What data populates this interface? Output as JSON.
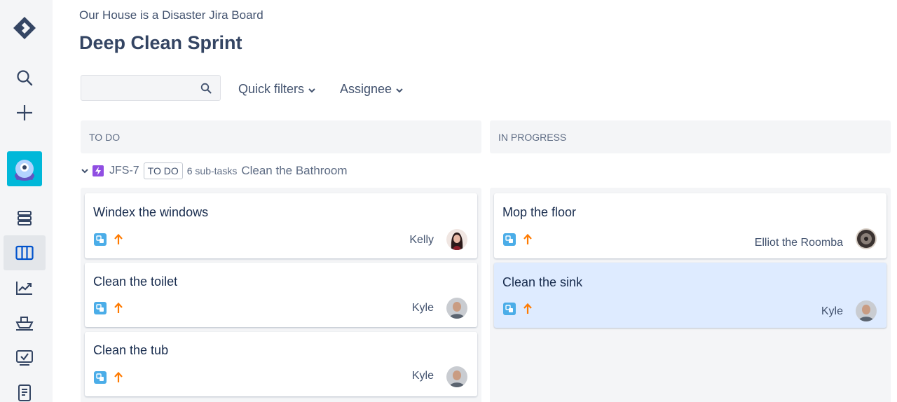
{
  "sidebar": {
    "items": [
      {
        "name": "jira-logo-icon"
      },
      {
        "name": "search-icon"
      },
      {
        "name": "create-icon"
      },
      {
        "name": "project-avatar"
      },
      {
        "name": "backlog-icon"
      },
      {
        "name": "board-icon"
      },
      {
        "name": "reports-icon"
      },
      {
        "name": "releases-icon"
      },
      {
        "name": "issues-icon"
      },
      {
        "name": "pages-icon"
      }
    ]
  },
  "header": {
    "breadcrumb": "Our House is a Disaster Jira Board",
    "title": "Deep Clean Sprint"
  },
  "filters": {
    "search_placeholder": "",
    "quick_filters": "Quick filters",
    "assignee": "Assignee"
  },
  "columns": [
    {
      "label": "TO DO"
    },
    {
      "label": "IN PROGRESS"
    }
  ],
  "swimlane": {
    "key": "JFS-7",
    "status": "TO DO",
    "subtasks": "6 sub-tasks",
    "title": "Clean the Bathroom"
  },
  "cards": {
    "todo": [
      {
        "title": "Windex the windows",
        "assignee": "Kelly",
        "type": "subtask-icon",
        "priority": "high-priority-icon"
      },
      {
        "title": "Clean the toilet",
        "assignee": "Kyle",
        "type": "subtask-icon",
        "priority": "high-priority-icon"
      },
      {
        "title": "Clean the tub",
        "assignee": "Kyle",
        "type": "subtask-icon",
        "priority": "high-priority-icon"
      }
    ],
    "in_progress": [
      {
        "title": "Mop the floor",
        "assignee": "Elliot the Roomba",
        "type": "subtask-icon",
        "priority": "high-priority-icon"
      },
      {
        "title": "Clean the sink",
        "assignee": "Kyle",
        "type": "subtask-icon",
        "priority": "high-priority-icon",
        "selected": true
      }
    ]
  },
  "colors": {
    "sidebar_bg": "#f4f5f7",
    "subtask_icon": "#4bade8",
    "priority_high": "#ff7a00",
    "epic_icon": "#904ee2",
    "selected_card": "#deebff"
  }
}
